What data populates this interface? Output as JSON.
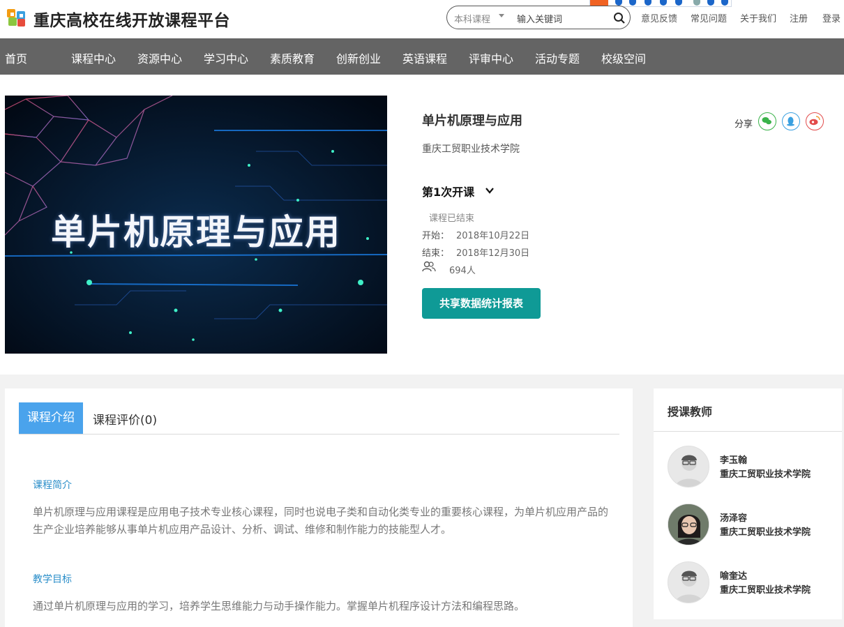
{
  "header": {
    "site_title": "重庆高校在线开放课程平台",
    "search": {
      "category": "本科课程",
      "placeholder": "输入关键词"
    },
    "links": [
      "意见反馈",
      "常见问题",
      "关于我们",
      "注册",
      "登录"
    ]
  },
  "nav": {
    "items": [
      "首页",
      "课程中心",
      "资源中心",
      "学习中心",
      "素质教育",
      "创新创业",
      "英语课程",
      "评审中心",
      "活动专题",
      "校级空间"
    ]
  },
  "course": {
    "cover_title": "单片机原理与应用",
    "title": "单片机原理与应用",
    "school": "重庆工贸职业技术学院",
    "session": "第1次开课",
    "status": "课程已结束",
    "start_label": "开始：",
    "start_date": "2018年10月22日",
    "end_label": "结束：",
    "end_date": "2018年12月30日",
    "enrolled": "694人",
    "report_button": "共享数据统计报表",
    "share_label": "分享"
  },
  "tabs": {
    "intro": "课程介绍",
    "reviews": "课程评价(0)"
  },
  "intro": {
    "summary_title": "课程简介",
    "summary_text": "单片机原理与应用课程是应用电子技术专业核心课程，同时也说电子类和自动化类专业的重要核心课程，为单片机应用产品的生产企业培养能够从事单片机应用产品设计、分析、调试、维修和制作能力的技能型人才。",
    "goal_title": "教学目标",
    "goal_text": "通过单片机原理与应用的学习，培养学生思维能力与动手操作能力。掌握单片机程序设计方法和编程思路。"
  },
  "teachers": {
    "heading": "授课教师",
    "list": [
      {
        "name": "李玉翰",
        "school": "重庆工贸职业技术学院"
      },
      {
        "name": "汤泽容",
        "school": "重庆工贸职业技术学院"
      },
      {
        "name": "喻奎达",
        "school": "重庆工贸职业技术学院"
      }
    ]
  },
  "colors": {
    "nav_bg": "#646464",
    "accent_teal": "#0f9a96",
    "tab_blue": "#4aa3ec",
    "section_blue": "#2a8ec9"
  },
  "icons": [
    "site-logo-icon",
    "caret-down-icon",
    "search-icon",
    "chevron-down-icon",
    "people-icon",
    "wechat-icon",
    "qq-icon",
    "weibo-icon",
    "avatar-placeholder-icon"
  ]
}
